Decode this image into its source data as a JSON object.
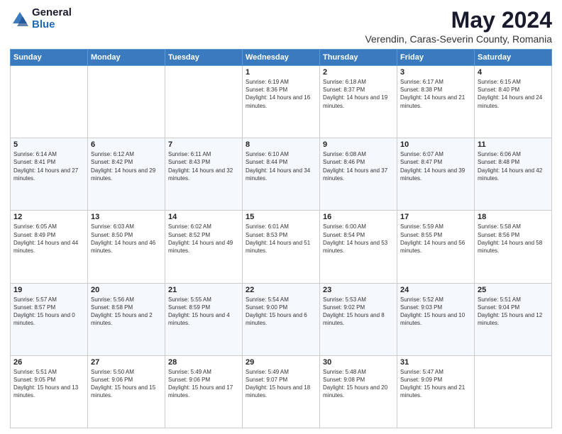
{
  "logo": {
    "general": "General",
    "blue": "Blue"
  },
  "title": "May 2024",
  "subtitle": "Verendin, Caras-Severin County, Romania",
  "days_of_week": [
    "Sunday",
    "Monday",
    "Tuesday",
    "Wednesday",
    "Thursday",
    "Friday",
    "Saturday"
  ],
  "weeks": [
    [
      {
        "day": "",
        "info": ""
      },
      {
        "day": "",
        "info": ""
      },
      {
        "day": "",
        "info": ""
      },
      {
        "day": "1",
        "info": "Sunrise: 6:19 AM\nSunset: 8:36 PM\nDaylight: 14 hours and 16 minutes."
      },
      {
        "day": "2",
        "info": "Sunrise: 6:18 AM\nSunset: 8:37 PM\nDaylight: 14 hours and 19 minutes."
      },
      {
        "day": "3",
        "info": "Sunrise: 6:17 AM\nSunset: 8:38 PM\nDaylight: 14 hours and 21 minutes."
      },
      {
        "day": "4",
        "info": "Sunrise: 6:15 AM\nSunset: 8:40 PM\nDaylight: 14 hours and 24 minutes."
      }
    ],
    [
      {
        "day": "5",
        "info": "Sunrise: 6:14 AM\nSunset: 8:41 PM\nDaylight: 14 hours and 27 minutes."
      },
      {
        "day": "6",
        "info": "Sunrise: 6:12 AM\nSunset: 8:42 PM\nDaylight: 14 hours and 29 minutes."
      },
      {
        "day": "7",
        "info": "Sunrise: 6:11 AM\nSunset: 8:43 PM\nDaylight: 14 hours and 32 minutes."
      },
      {
        "day": "8",
        "info": "Sunrise: 6:10 AM\nSunset: 8:44 PM\nDaylight: 14 hours and 34 minutes."
      },
      {
        "day": "9",
        "info": "Sunrise: 6:08 AM\nSunset: 8:46 PM\nDaylight: 14 hours and 37 minutes."
      },
      {
        "day": "10",
        "info": "Sunrise: 6:07 AM\nSunset: 8:47 PM\nDaylight: 14 hours and 39 minutes."
      },
      {
        "day": "11",
        "info": "Sunrise: 6:06 AM\nSunset: 8:48 PM\nDaylight: 14 hours and 42 minutes."
      }
    ],
    [
      {
        "day": "12",
        "info": "Sunrise: 6:05 AM\nSunset: 8:49 PM\nDaylight: 14 hours and 44 minutes."
      },
      {
        "day": "13",
        "info": "Sunrise: 6:03 AM\nSunset: 8:50 PM\nDaylight: 14 hours and 46 minutes."
      },
      {
        "day": "14",
        "info": "Sunrise: 6:02 AM\nSunset: 8:52 PM\nDaylight: 14 hours and 49 minutes."
      },
      {
        "day": "15",
        "info": "Sunrise: 6:01 AM\nSunset: 8:53 PM\nDaylight: 14 hours and 51 minutes."
      },
      {
        "day": "16",
        "info": "Sunrise: 6:00 AM\nSunset: 8:54 PM\nDaylight: 14 hours and 53 minutes."
      },
      {
        "day": "17",
        "info": "Sunrise: 5:59 AM\nSunset: 8:55 PM\nDaylight: 14 hours and 56 minutes."
      },
      {
        "day": "18",
        "info": "Sunrise: 5:58 AM\nSunset: 8:56 PM\nDaylight: 14 hours and 58 minutes."
      }
    ],
    [
      {
        "day": "19",
        "info": "Sunrise: 5:57 AM\nSunset: 8:57 PM\nDaylight: 15 hours and 0 minutes."
      },
      {
        "day": "20",
        "info": "Sunrise: 5:56 AM\nSunset: 8:58 PM\nDaylight: 15 hours and 2 minutes."
      },
      {
        "day": "21",
        "info": "Sunrise: 5:55 AM\nSunset: 8:59 PM\nDaylight: 15 hours and 4 minutes."
      },
      {
        "day": "22",
        "info": "Sunrise: 5:54 AM\nSunset: 9:00 PM\nDaylight: 15 hours and 6 minutes."
      },
      {
        "day": "23",
        "info": "Sunrise: 5:53 AM\nSunset: 9:02 PM\nDaylight: 15 hours and 8 minutes."
      },
      {
        "day": "24",
        "info": "Sunrise: 5:52 AM\nSunset: 9:03 PM\nDaylight: 15 hours and 10 minutes."
      },
      {
        "day": "25",
        "info": "Sunrise: 5:51 AM\nSunset: 9:04 PM\nDaylight: 15 hours and 12 minutes."
      }
    ],
    [
      {
        "day": "26",
        "info": "Sunrise: 5:51 AM\nSunset: 9:05 PM\nDaylight: 15 hours and 13 minutes."
      },
      {
        "day": "27",
        "info": "Sunrise: 5:50 AM\nSunset: 9:06 PM\nDaylight: 15 hours and 15 minutes."
      },
      {
        "day": "28",
        "info": "Sunrise: 5:49 AM\nSunset: 9:06 PM\nDaylight: 15 hours and 17 minutes."
      },
      {
        "day": "29",
        "info": "Sunrise: 5:49 AM\nSunset: 9:07 PM\nDaylight: 15 hours and 18 minutes."
      },
      {
        "day": "30",
        "info": "Sunrise: 5:48 AM\nSunset: 9:08 PM\nDaylight: 15 hours and 20 minutes."
      },
      {
        "day": "31",
        "info": "Sunrise: 5:47 AM\nSunset: 9:09 PM\nDaylight: 15 hours and 21 minutes."
      },
      {
        "day": "",
        "info": ""
      }
    ]
  ]
}
